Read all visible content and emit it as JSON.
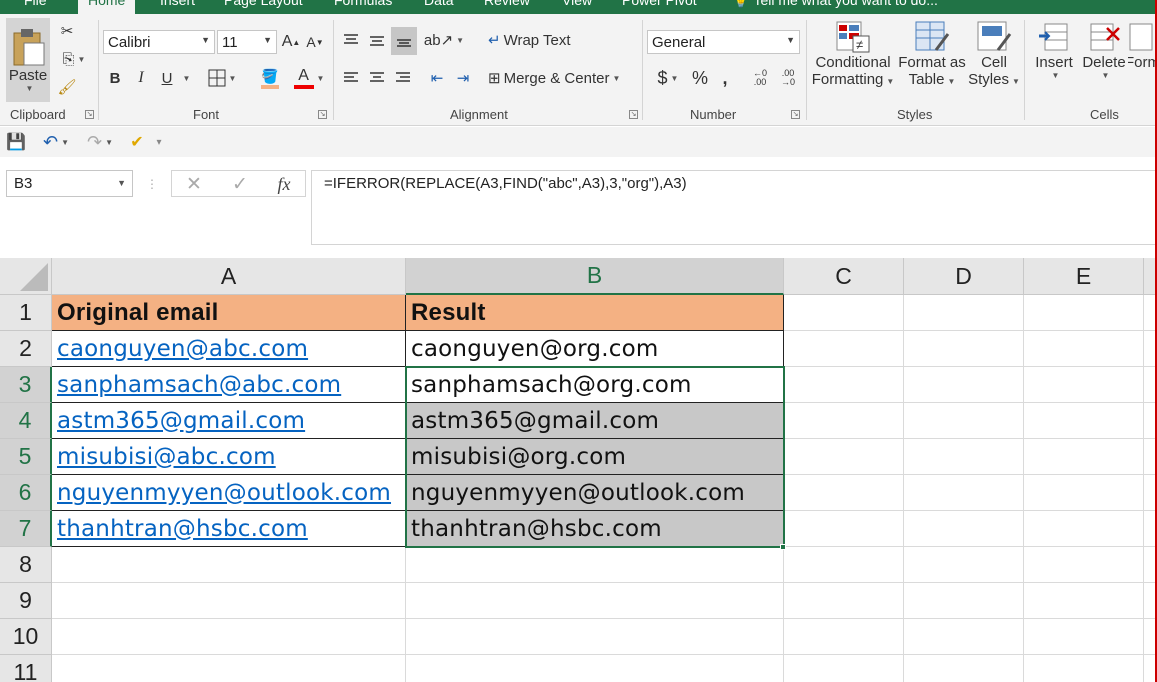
{
  "tabs": [
    "File",
    "Home",
    "Insert",
    "Page Layout",
    "Formulas",
    "Data",
    "Review",
    "View",
    "Power Pivot",
    "Tell me what you want to do..."
  ],
  "ribbon": {
    "clipboard": {
      "paste": "Paste",
      "label": "Clipboard"
    },
    "font": {
      "name": "Calibri",
      "size": "11",
      "bold": "B",
      "italic": "I",
      "underline": "U",
      "label": "Font"
    },
    "alignment": {
      "wrap_text": "Wrap Text",
      "merge_center": "Merge & Center",
      "label": "Alignment"
    },
    "number": {
      "format": "General",
      "currency": "$",
      "percent": "%",
      "comma": ",",
      "label": "Number"
    },
    "styles": {
      "conditional": "Conditional",
      "formatting": "Formatting",
      "format_as": "Format as",
      "table": "Table",
      "cell": "Cell",
      "styles": "Styles",
      "label": "Styles"
    },
    "cells": {
      "insert": "Insert",
      "delete": "Delete",
      "format": "Form",
      "label": "Cells"
    }
  },
  "formula_bar": {
    "name_box": "B3",
    "fx": "fx",
    "formula": "=IFERROR(REPLACE(A3,FIND(\"abc\",A3),3,\"org\"),A3)"
  },
  "columns": [
    "A",
    "B",
    "C",
    "D",
    "E"
  ],
  "rows": [
    "1",
    "2",
    "3",
    "4",
    "5",
    "6",
    "7",
    "8",
    "9",
    "10",
    "11"
  ],
  "sheet": {
    "header_a": "Original email",
    "header_b": "Result",
    "col_a": [
      "caonguyen@abc.com",
      "sanphamsach@abc.com",
      "astm365@gmail.com",
      "misubisi@abc.com",
      "nguyenmyyen@outlook.com",
      "thanhtran@hsbc.com"
    ],
    "col_b": [
      "caonguyen@org.com",
      "sanphamsach@org.com",
      "astm365@gmail.com",
      "misubisi@org.com",
      "nguyenmyyen@outlook.com",
      "thanhtran@hsbc.com"
    ]
  },
  "colors": {
    "accent": "#217346",
    "header_fill": "#f4b183",
    "link": "#0563c1",
    "selection": "#c8c8c8"
  }
}
